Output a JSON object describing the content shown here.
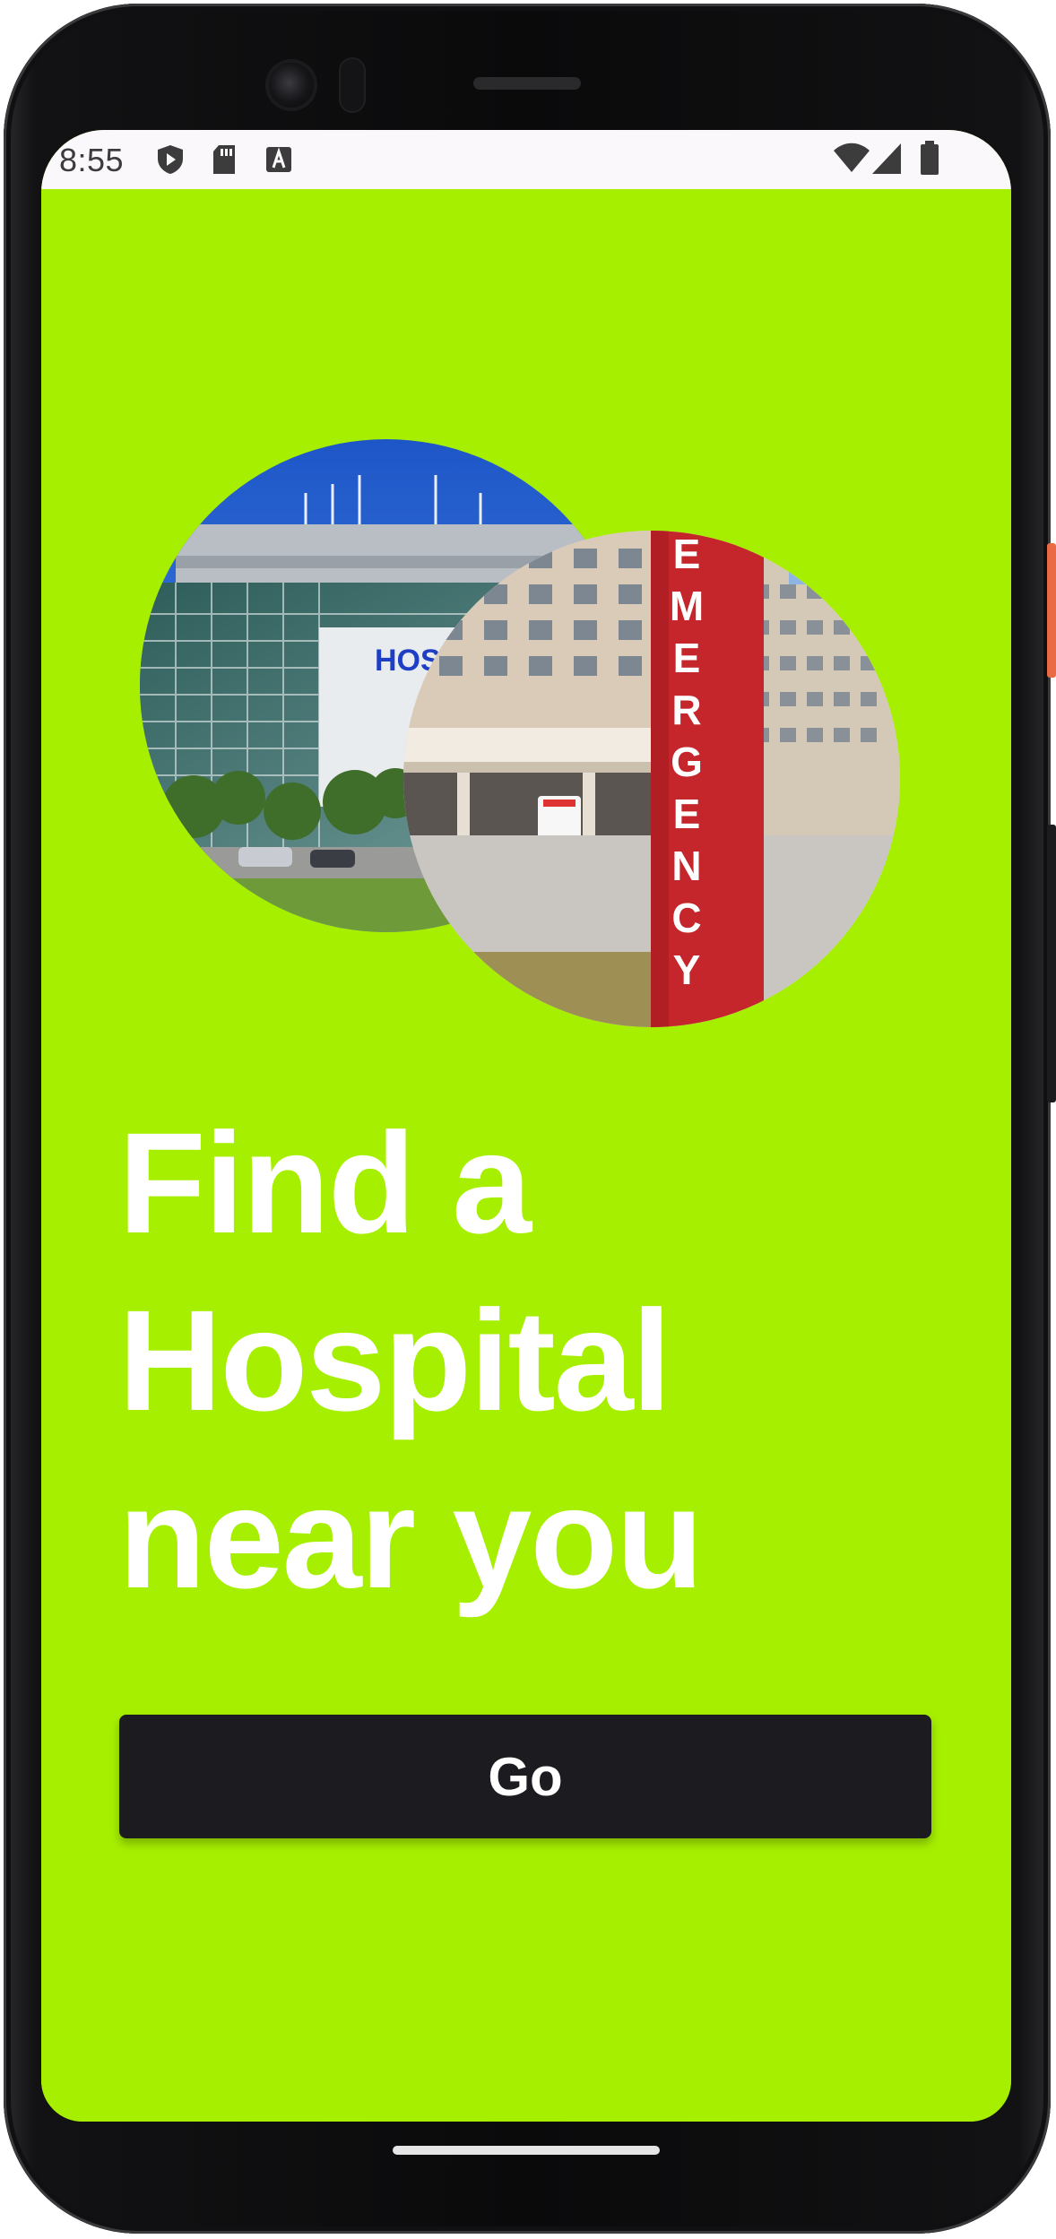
{
  "status_bar": {
    "time": "8:55",
    "left_icons": [
      "play-protect-icon",
      "sd-card-icon",
      "a-icon"
    ],
    "right_icons": [
      "wifi-icon",
      "cell-signal-icon",
      "battery-icon"
    ]
  },
  "hero": {
    "images": [
      {
        "name": "hospital-building-photo",
        "sign_text": "HOSP"
      },
      {
        "name": "emergency-entrance-photo",
        "sign_text": "EMERGENCY"
      }
    ]
  },
  "headline": {
    "line1": "Find a",
    "line2": "Hospital",
    "line3": "near you"
  },
  "go_button": {
    "label": "Go"
  },
  "colors": {
    "background": "#a6ef00",
    "button": "#1c1b1f",
    "text": "#ffffff",
    "status_bar": "#fbf8fb"
  }
}
